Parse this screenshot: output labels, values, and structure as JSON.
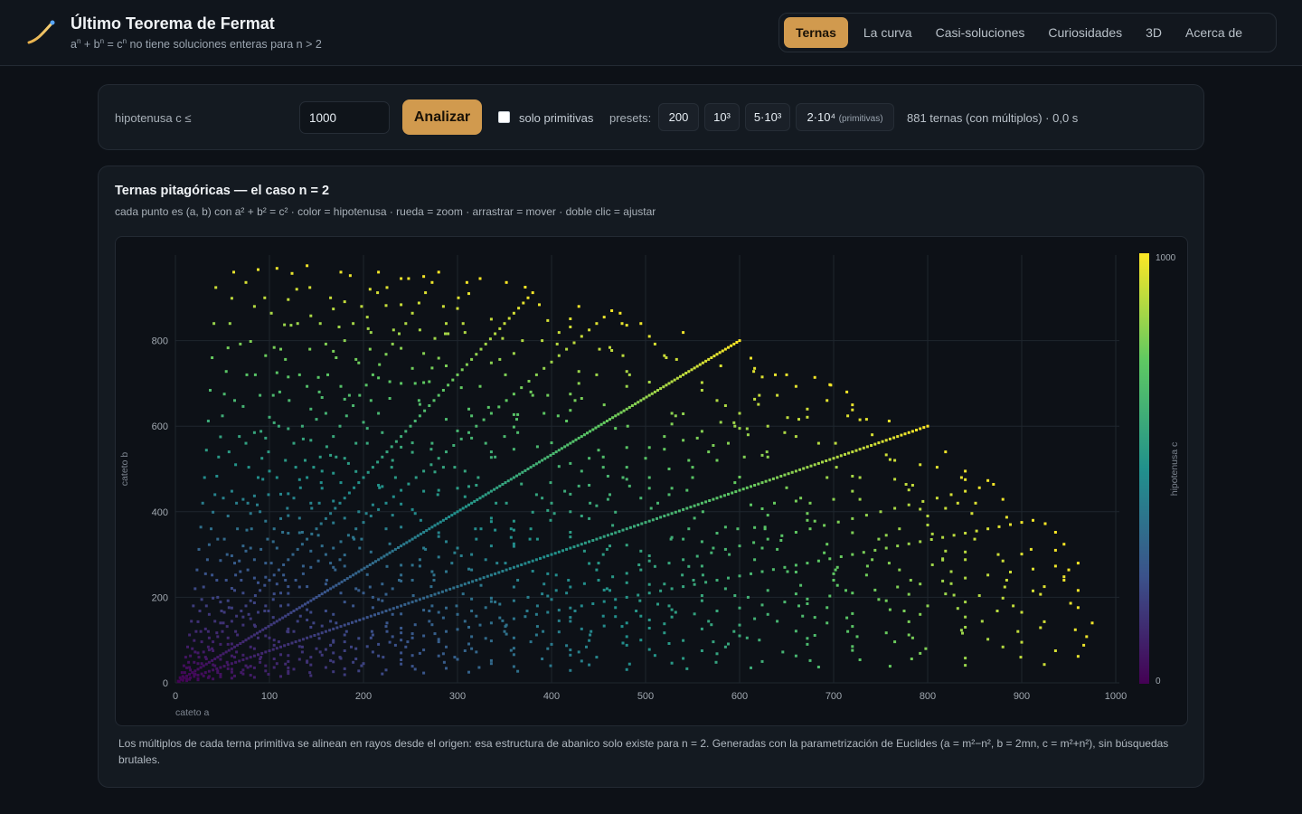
{
  "header": {
    "title": "Último Teorema de Fermat",
    "subtitle_parts": [
      "a",
      "n",
      " + b",
      "n",
      " = c",
      "n",
      " no tiene soluciones enteras para n > 2"
    ],
    "tabs": [
      "Ternas",
      "La curva",
      "Casi-soluciones",
      "Curiosidades",
      "3D",
      "Acerca de"
    ],
    "active_tab": "Ternas",
    "logo_icon": "curve-icon"
  },
  "controls": {
    "hyp_label": "hipotenusa c ≤",
    "hyp_value": "1000",
    "analyze_label": "Analizar",
    "primitive_label": "solo primitivas",
    "primitive_checked": false,
    "presets_label": "presets:",
    "presets": [
      "200",
      "10³",
      "5·10³",
      "2·10⁴"
    ],
    "preset_note": "(primitivas)",
    "status": "881 ternas (con múltiplos) · 0,0 s"
  },
  "card": {
    "title": "Ternas pitagóricas — el caso n = 2",
    "description": "cada punto es (a, b) con a² + b² = c² · color = hipotenusa · rueda = zoom · arrastrar = mover · doble clic = ajustar",
    "footnote": "Los múltiplos de cada terna primitiva se alinean en rayos desde el origen: esa estructura de abanico solo existe para n = 2. Generadas con la parametrización de Euclides (a = m²−n², b = 2mn, c = m²+n²), sin búsquedas brutales."
  },
  "colors": {
    "accent": "#d19a4e",
    "colormap": "viridis"
  },
  "chart_data": {
    "type": "scatter",
    "xlabel": "cateto a",
    "ylabel": "cateto b",
    "colorbar_label": "hipotenusa c",
    "xlim": [
      0,
      1000
    ],
    "ylim": [
      0,
      1000
    ],
    "xticks": [
      0,
      100,
      200,
      300,
      400,
      500,
      600,
      700,
      800,
      900,
      1000
    ],
    "yticks": [
      0,
      200,
      400,
      600,
      800
    ],
    "color_range": [
      0,
      1000
    ],
    "colorbar_ticks": [
      "1000",
      "0"
    ],
    "grid": true,
    "points_rule": "all integer (a, b) with a² + b² = c², c ≤ 1000, 0 < a < b ≤ ~980 plus points with a > b",
    "max_hypotenuse": 1000
  }
}
